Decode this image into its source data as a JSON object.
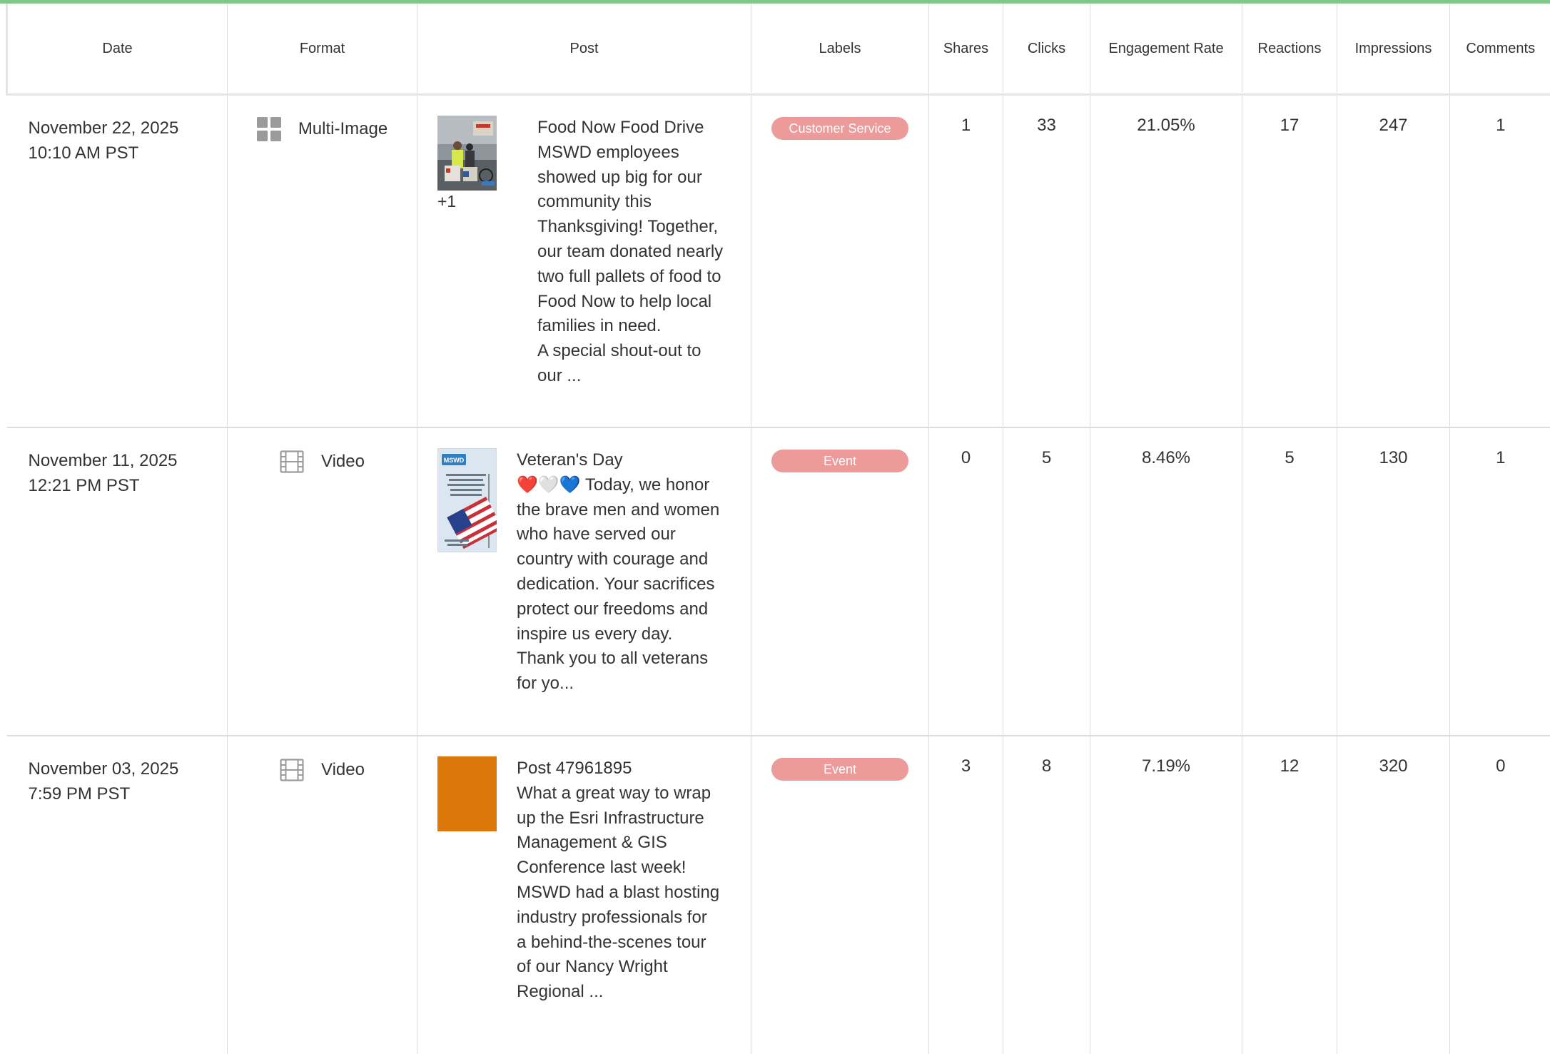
{
  "columns": [
    "Date",
    "Format",
    "Post",
    "Labels",
    "Shares",
    "Clicks",
    "Engagement Rate",
    "Reactions",
    "Impressions",
    "Comments"
  ],
  "colors": {
    "accent_bar": "#7fc88a",
    "label_bg": "#ec9a9a",
    "label_text": "#ffffff"
  },
  "rows": [
    {
      "date": "November 22, 2025",
      "time": "10:10 AM PST",
      "format": "Multi-Image",
      "format_icon": "grid-icon",
      "thumb_more": "+1",
      "post_text": "Food Now Food Drive\nMSWD employees\nshowed up big for our\ncommunity this\nThanksgiving! Together,\nour team donated nearly\ntwo full pallets of food to\nFood Now to help local\nfamilies in need.\nA special shout-out to\nour ...",
      "label": "Customer Service",
      "shares": "1",
      "clicks": "33",
      "engagement_rate": "21.05%",
      "reactions": "17",
      "impressions": "247",
      "comments": "1"
    },
    {
      "date": "November 11, 2025",
      "time": "12:21 PM PST",
      "format": "Video",
      "format_icon": "film-icon",
      "thumb_badge": "MSWD",
      "post_text": "Veteran's Day\n❤️🤍💙 Today, we honor\nthe brave men and women\nwho have served our\ncountry with courage and\ndedication. Your sacrifices\nprotect our freedoms and\ninspire us every day.\nThank you to all veterans\nfor yo...",
      "label": "Event",
      "shares": "0",
      "clicks": "5",
      "engagement_rate": "8.46%",
      "reactions": "5",
      "impressions": "130",
      "comments": "1"
    },
    {
      "date": "November 03, 2025",
      "time": "7:59 PM PST",
      "format": "Video",
      "format_icon": "film-icon",
      "thumb_color": "#dc7709",
      "post_text": "Post 47961895\nWhat a great way to wrap\nup the Esri Infrastructure\nManagement & GIS\nConference last week!\nMSWD had a blast hosting\nindustry professionals for\na behind-the-scenes tour\nof our Nancy Wright\nRegional ...",
      "label": "Event",
      "shares": "3",
      "clicks": "8",
      "engagement_rate": "7.19%",
      "reactions": "12",
      "impressions": "320",
      "comments": "0"
    }
  ]
}
